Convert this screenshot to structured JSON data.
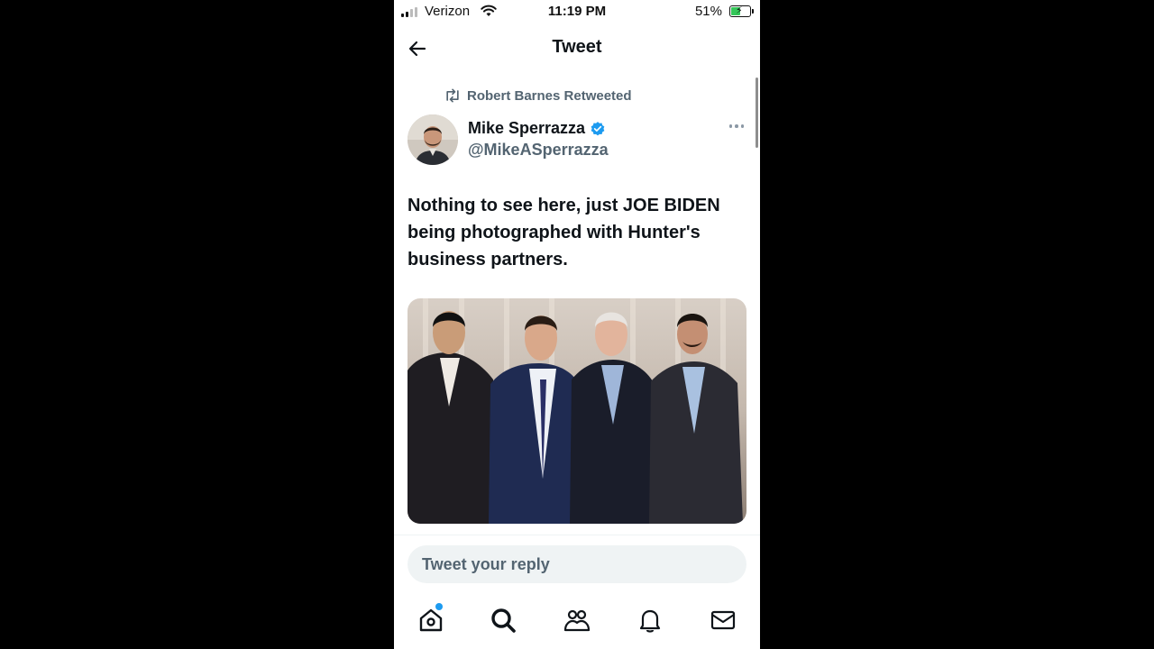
{
  "status_bar": {
    "carrier": "Verizon",
    "time": "11:19 PM",
    "battery_percent": "51%",
    "battery_level": 0.51,
    "charging": true
  },
  "header": {
    "title": "Tweet",
    "back_icon": "back-arrow-icon"
  },
  "tweet": {
    "retweeted_by": "Robert Barnes Retweeted",
    "author_name": "Mike Sperrazza",
    "author_handle": "@MikeASperrazza",
    "verified": true,
    "text_lines": [
      "Nothing to see here, just JOE BIDEN",
      "being photographed with Hunter's",
      "business partners."
    ],
    "media_alt_icon": "photo-of-four-men-in-suits"
  },
  "reply": {
    "placeholder": "Tweet your reply"
  },
  "tab_bar": {
    "items": [
      "home-icon",
      "search-icon",
      "communities-icon",
      "notifications-icon",
      "messages-icon"
    ],
    "home_has_notification_dot": true
  },
  "colors": {
    "accent": "#1d9bf0",
    "text_primary": "#0f1419",
    "text_secondary": "#536471",
    "battery": "#34c759"
  }
}
